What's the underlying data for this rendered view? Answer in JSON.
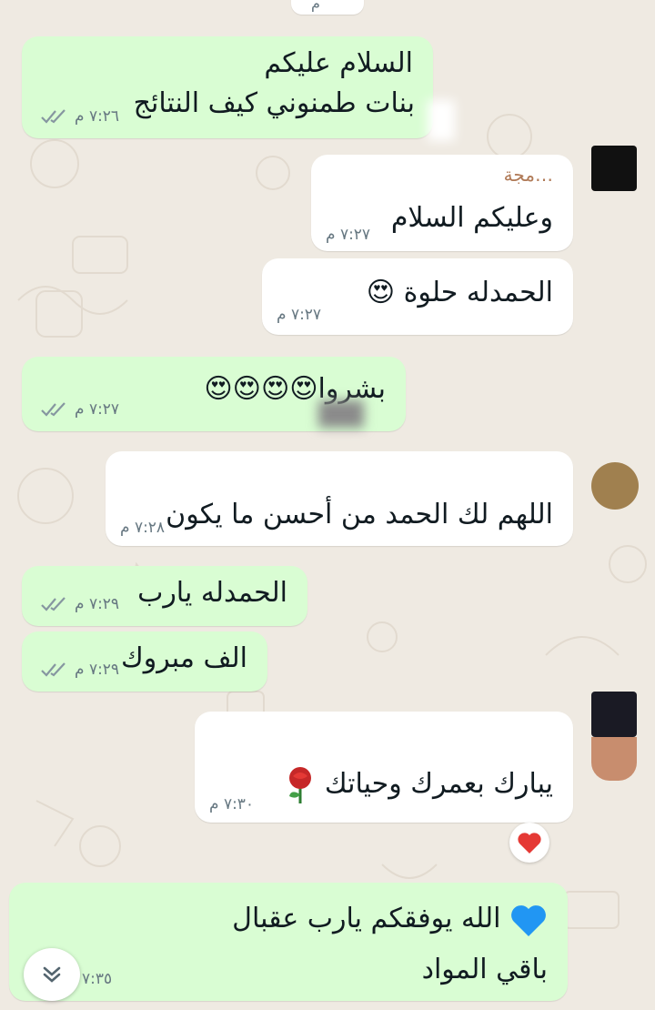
{
  "chat": {
    "top_fragment": "م",
    "messages": [
      {
        "id": 1,
        "direction": "outgoing",
        "lines": [
          "السلام عليكم",
          "بنات طمنوني كيف النتائج"
        ],
        "time": "٧:٢٦ م"
      },
      {
        "id": 2,
        "direction": "incoming",
        "sender": "…مجة",
        "lines": [
          "وعليكم السلام"
        ],
        "time": "٧:٢٧ م"
      },
      {
        "id": 3,
        "direction": "incoming",
        "lines": [
          "الحمدله حلوة 😍"
        ],
        "time": "٧:٢٧ م"
      },
      {
        "id": 4,
        "direction": "outgoing",
        "lines": [
          "بشروا😍😍😍😍"
        ],
        "time": "٧:٢٧ م"
      },
      {
        "id": 5,
        "direction": "incoming",
        "lines": [
          "اللهم لك الحمد من أحسن ما يكون"
        ],
        "time": "٧:٢٨ م"
      },
      {
        "id": 6,
        "direction": "outgoing",
        "lines": [
          "الحمدله يارب"
        ],
        "time": "٧:٢٩ م"
      },
      {
        "id": 7,
        "direction": "outgoing",
        "lines": [
          "الف مبروك"
        ],
        "time": "٧:٢٩ م"
      },
      {
        "id": 8,
        "direction": "incoming",
        "lines": [
          "يبارك بعمرك وحياتك"
        ],
        "time": "٧:٣٠ م",
        "reaction": "heart"
      },
      {
        "id": 9,
        "direction": "outgoing",
        "lines": [
          "الله يوفقكم يارب عقبال",
          "باقي المواد"
        ],
        "time": "٧:٣٥"
      }
    ]
  },
  "colors": {
    "outgoing_bubble": "#d9fdd3",
    "incoming_bubble": "#ffffff",
    "background": "#efeae2",
    "read_ticks": "#8696a0",
    "sender_name": "#b07a57"
  },
  "icons": {
    "read_status": "double-check-icon",
    "scroll_down": "double-chevron-down-icon",
    "reaction": "red-heart-icon",
    "rose": "rose-icon",
    "heart_eyes": "heart-eyes-emoji",
    "blue_heart": "blue-heart-icon"
  }
}
